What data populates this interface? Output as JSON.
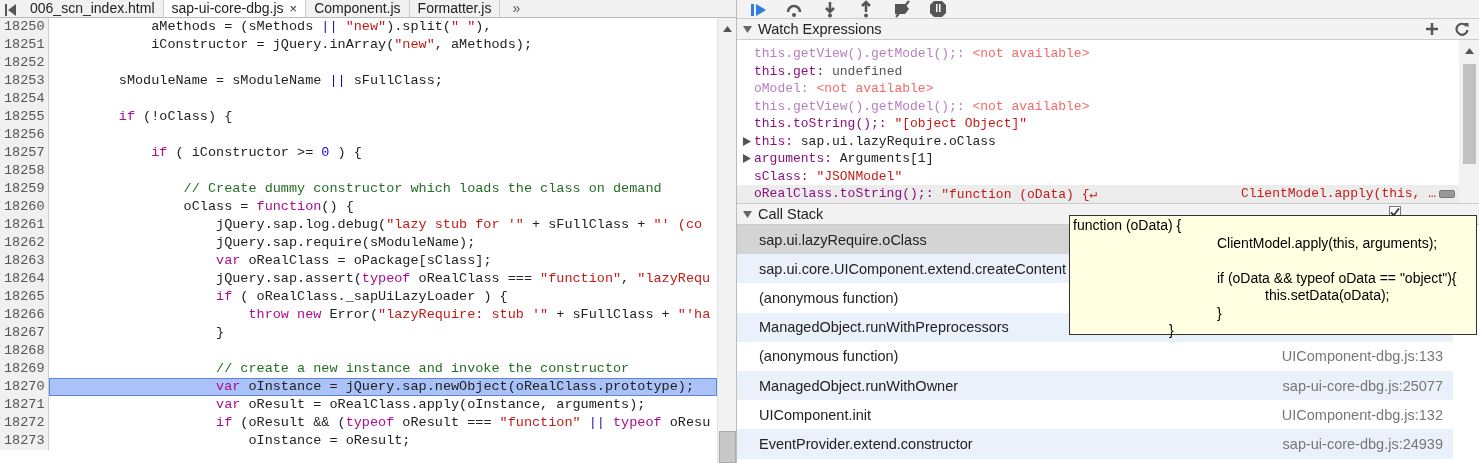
{
  "editor": {
    "tabs": [
      {
        "label": "006_scn_index.html",
        "selected": false
      },
      {
        "label": "sap-ui-core-dbg.js",
        "selected": true,
        "close": "×"
      },
      {
        "label": "Component.js",
        "selected": false
      },
      {
        "label": "Formatter.js",
        "selected": false
      }
    ],
    "overflow": "»",
    "lines": [
      {
        "number": "18250",
        "highlighted": false,
        "tokens": [
          {
            "kind": "plain",
            "text": "            aMethods = (sMethods "
          },
          {
            "kind": "operator",
            "text": "||"
          },
          {
            "kind": "string",
            "text": " \"new\""
          },
          {
            "kind": "plain",
            "text": ").split("
          },
          {
            "kind": "string",
            "text": "\" \""
          },
          {
            "kind": "plain",
            "text": "),"
          }
        ]
      },
      {
        "number": "18251",
        "highlighted": false,
        "tokens": [
          {
            "kind": "plain",
            "text": "            iConstructor = jQuery.inArray("
          },
          {
            "kind": "string",
            "text": "\"new\""
          },
          {
            "kind": "plain",
            "text": ", aMethods);"
          }
        ]
      },
      {
        "number": "18252",
        "highlighted": false
      },
      {
        "number": "18253",
        "highlighted": false,
        "tokens": [
          {
            "kind": "plain",
            "text": "        sModuleName = sModuleName "
          },
          {
            "kind": "operator",
            "text": "||"
          },
          {
            "kind": "plain",
            "text": " sFullClass;"
          }
        ]
      },
      {
        "number": "18254",
        "highlighted": false
      },
      {
        "number": "18255",
        "highlighted": false,
        "tokens": [
          {
            "kind": "keyword",
            "text": "        if"
          },
          {
            "kind": "plain",
            "text": " (!oClass) {"
          }
        ]
      },
      {
        "number": "18256",
        "highlighted": false
      },
      {
        "number": "18257",
        "highlighted": false,
        "tokens": [
          {
            "kind": "keyword",
            "text": "            if"
          },
          {
            "kind": "plain",
            "text": " ( iConstructor >= "
          },
          {
            "kind": "number",
            "text": "0"
          },
          {
            "kind": "plain",
            "text": " ) {"
          }
        ]
      },
      {
        "number": "18258",
        "highlighted": false
      },
      {
        "number": "18259",
        "highlighted": false,
        "tokens": [
          {
            "kind": "comment",
            "text": "                // Create dummy constructor which loads the class on demand"
          }
        ]
      },
      {
        "number": "18260",
        "highlighted": false,
        "tokens": [
          {
            "kind": "plain",
            "text": "                oClass = "
          },
          {
            "kind": "keyword",
            "text": "function"
          },
          {
            "kind": "plain",
            "text": "() {"
          }
        ]
      },
      {
        "number": "18261",
        "highlighted": false,
        "tokens": [
          {
            "kind": "plain",
            "text": "                    jQuery.sap.log.debug("
          },
          {
            "kind": "string",
            "text": "\"lazy stub for '\""
          },
          {
            "kind": "plain",
            "text": " + sFullClass + "
          },
          {
            "kind": "string",
            "text": "\"' (co"
          }
        ]
      },
      {
        "number": "18262",
        "highlighted": false,
        "tokens": [
          {
            "kind": "plain",
            "text": "                    jQuery.sap.require(sModuleName);"
          }
        ]
      },
      {
        "number": "18263",
        "highlighted": false,
        "tokens": [
          {
            "kind": "keyword",
            "text": "                    var"
          },
          {
            "kind": "plain",
            "text": " oRealClass = oPackage[sClass];"
          }
        ]
      },
      {
        "number": "18264",
        "highlighted": false,
        "tokens": [
          {
            "kind": "plain",
            "text": "                    jQuery.sap.assert("
          },
          {
            "kind": "keyword",
            "text": "typeof"
          },
          {
            "kind": "plain",
            "text": " oRealClass === "
          },
          {
            "kind": "string",
            "text": "\"function\""
          },
          {
            "kind": "plain",
            "text": ", "
          },
          {
            "kind": "string",
            "text": "\"lazyRequ"
          }
        ]
      },
      {
        "number": "18265",
        "highlighted": false,
        "tokens": [
          {
            "kind": "keyword",
            "text": "                    if"
          },
          {
            "kind": "plain",
            "text": " ( oRealClass._sapUiLazyLoader ) {"
          }
        ]
      },
      {
        "number": "18266",
        "highlighted": false,
        "tokens": [
          {
            "kind": "keyword",
            "text": "                        throw new"
          },
          {
            "kind": "plain",
            "text": " Error("
          },
          {
            "kind": "string",
            "text": "\"lazyRequire: stub '\""
          },
          {
            "kind": "plain",
            "text": " + sFullClass + "
          },
          {
            "kind": "string",
            "text": "\"'ha"
          }
        ]
      },
      {
        "number": "18267",
        "highlighted": false,
        "tokens": [
          {
            "kind": "plain",
            "text": "                    }"
          }
        ]
      },
      {
        "number": "18268",
        "highlighted": false
      },
      {
        "number": "18269",
        "highlighted": false,
        "tokens": [
          {
            "kind": "comment",
            "text": "                    // create a new instance and invoke the constructor"
          }
        ]
      },
      {
        "number": "18270",
        "highlighted": true,
        "tokens": [
          {
            "kind": "keyword",
            "text": "                    var"
          },
          {
            "kind": "plain",
            "text": " oInstance = jQuery.sap.newObject(oRealClass.prototype);"
          }
        ]
      },
      {
        "number": "18271",
        "highlighted": false,
        "tokens": [
          {
            "kind": "keyword",
            "text": "                    var"
          },
          {
            "kind": "plain",
            "text": " oResult = oRealClass.apply(oInstance, arguments);"
          }
        ]
      },
      {
        "number": "18272",
        "highlighted": false,
        "tokens": [
          {
            "kind": "keyword",
            "text": "                    if"
          },
          {
            "kind": "plain",
            "text": " (oResult && ("
          },
          {
            "kind": "keyword",
            "text": "typeof"
          },
          {
            "kind": "plain",
            "text": " oResult === "
          },
          {
            "kind": "string",
            "text": "\"function\" "
          },
          {
            "kind": "operator",
            "text": "||"
          },
          {
            "kind": "keyword",
            "text": " typeof"
          },
          {
            "kind": "plain",
            "text": " oResu"
          }
        ]
      },
      {
        "number": "18273",
        "highlighted": false,
        "tokens": [
          {
            "kind": "plain",
            "text": "                        oInstance = oResult;"
          }
        ]
      }
    ]
  },
  "debugger": {
    "watch": {
      "title": "Watch Expressions",
      "items": [
        {
          "name": "this.getView().getModel();:",
          "value": "<not available>",
          "kind": "unavailable",
          "expandable": false,
          "selected": false
        },
        {
          "name": "this.get:",
          "value": "undefined",
          "kind": "undefined",
          "expandable": false,
          "selected": false
        },
        {
          "name": "oModel:",
          "value": "<not available>",
          "kind": "unavailable",
          "expandable": false,
          "selected": false
        },
        {
          "name": "this.getView().getModel();:",
          "value": "<not available>",
          "kind": "unavailable",
          "expandable": false,
          "selected": false
        },
        {
          "name": "this.toString();:",
          "value": "\"[object Object]\"",
          "kind": "string",
          "expandable": false,
          "selected": false
        },
        {
          "name": "this:",
          "value": "sap.ui.lazyRequire.oClass",
          "kind": "object",
          "expandable": true,
          "selected": false
        },
        {
          "name": "arguments:",
          "value": "Arguments[1]",
          "kind": "object",
          "expandable": true,
          "selected": false
        },
        {
          "name": "sClass:",
          "value": "\"JSONModel\"",
          "kind": "string",
          "expandable": false,
          "selected": false
        },
        {
          "name": "oRealClass.toString();:",
          "value": "\"function (oData) {↵",
          "continuation": "ClientModel.apply(this, …",
          "kind": "string",
          "expandable": false,
          "selected": true
        }
      ]
    },
    "call_stack": {
      "title": "Call Stack",
      "async_checked": true,
      "frames": [
        {
          "name": "sap.ui.lazyRequire.oClass",
          "selected": true
        },
        {
          "name": "sap.ui.core.UIComponent.extend.createContent",
          "selected": false
        },
        {
          "name": "(anonymous function)",
          "selected": false
        },
        {
          "name": "ManagedObject.runWithPreprocessors",
          "selected": false
        },
        {
          "name": "(anonymous function)",
          "location": "UIComponent-dbg.js:133",
          "selected": false
        },
        {
          "name": "ManagedObject.runWithOwner",
          "location": "sap-ui-core-dbg.js:25077",
          "selected": false
        },
        {
          "name": "UIComponent.init",
          "location": "UIComponent-dbg.js:132",
          "selected": false
        },
        {
          "name": "EventProvider.extend.constructor",
          "location": "sap-ui-core-dbg.js:24939",
          "selected": false
        }
      ]
    },
    "tooltip": {
      "text": "function (oData) {\n\t\t\tClientModel.apply(this, arguments);\n\n\t\t\tif (oData && typeof oData == \"object\"){\n\t\t\t\tthis.setData(oData);\n\t\t\t}\n\t\t}"
    }
  }
}
